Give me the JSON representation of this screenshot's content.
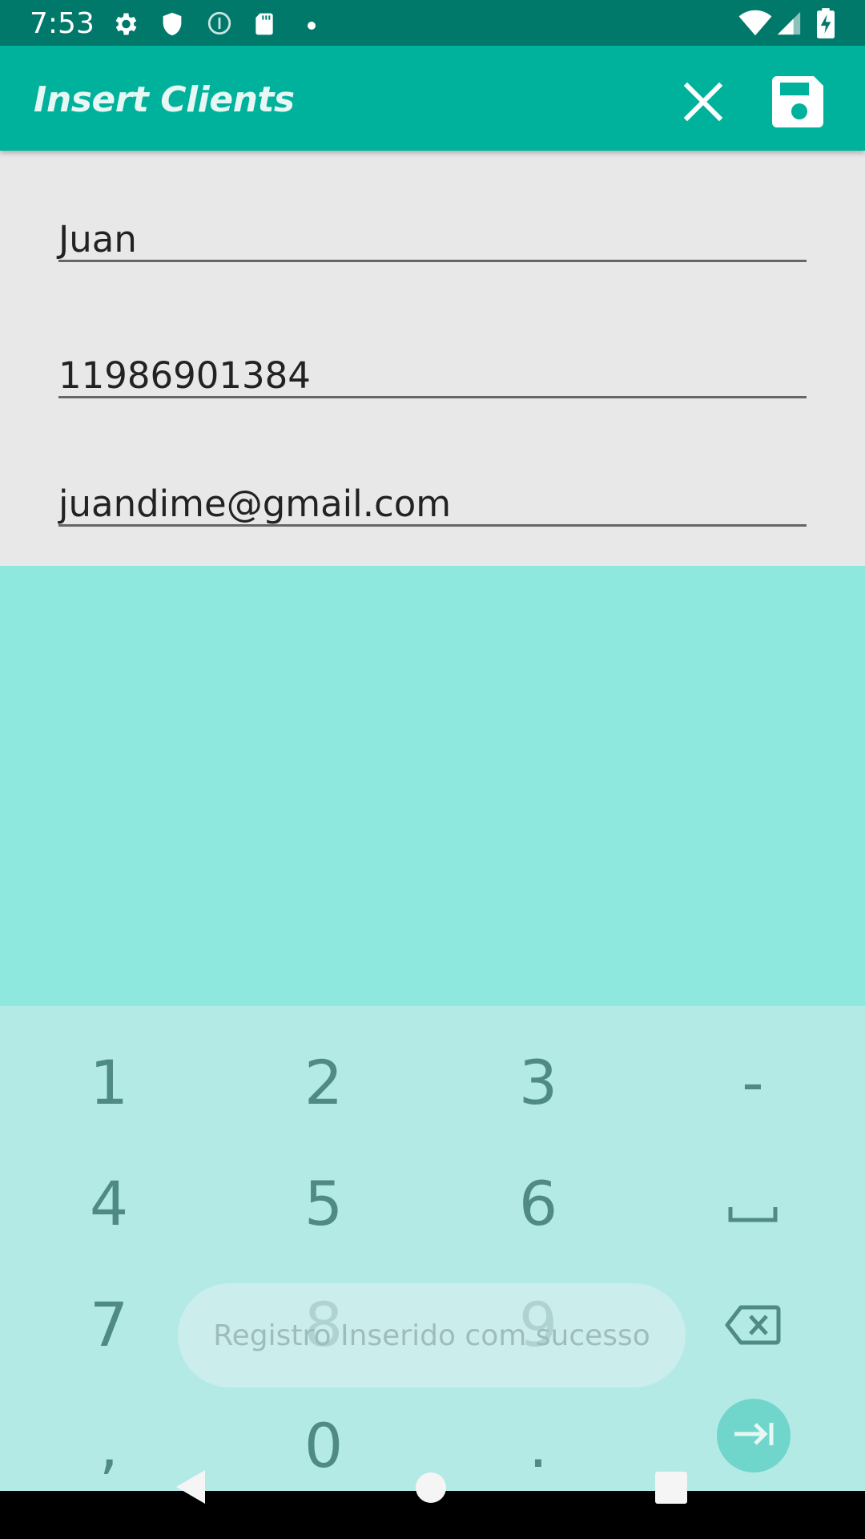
{
  "status_bar": {
    "time": "7:53",
    "left_icons": [
      "settings-icon",
      "shield-icon",
      "info-circle-icon",
      "sd-card-icon",
      "notification-dot-icon"
    ],
    "right_icons": [
      "wifi-icon",
      "cellular-signal-icon",
      "battery-charging-icon"
    ]
  },
  "app_bar": {
    "title": "Insert Clients",
    "background": "#00b29c",
    "actions": [
      "close-icon",
      "save-icon"
    ]
  },
  "form": {
    "name_value": "Juan",
    "phone_value": "11986901384",
    "email_value": "juandime@gmail.com"
  },
  "keyboard": {
    "keys": [
      "1",
      "2",
      "3",
      "-",
      "4",
      "5",
      "6",
      "7",
      "8",
      "9",
      ",",
      "0",
      "."
    ],
    "space_icon": "space-icon",
    "backspace_icon": "backspace-icon",
    "enter_icon": "tab-next-icon"
  },
  "toast": {
    "message": "Registro Inserido com sucesso"
  },
  "colors": {
    "status_bar": "#00796b",
    "accent": "#00b29c",
    "keyboard_bg": "#b4eae5",
    "panel_bg": "#8ee8de"
  }
}
